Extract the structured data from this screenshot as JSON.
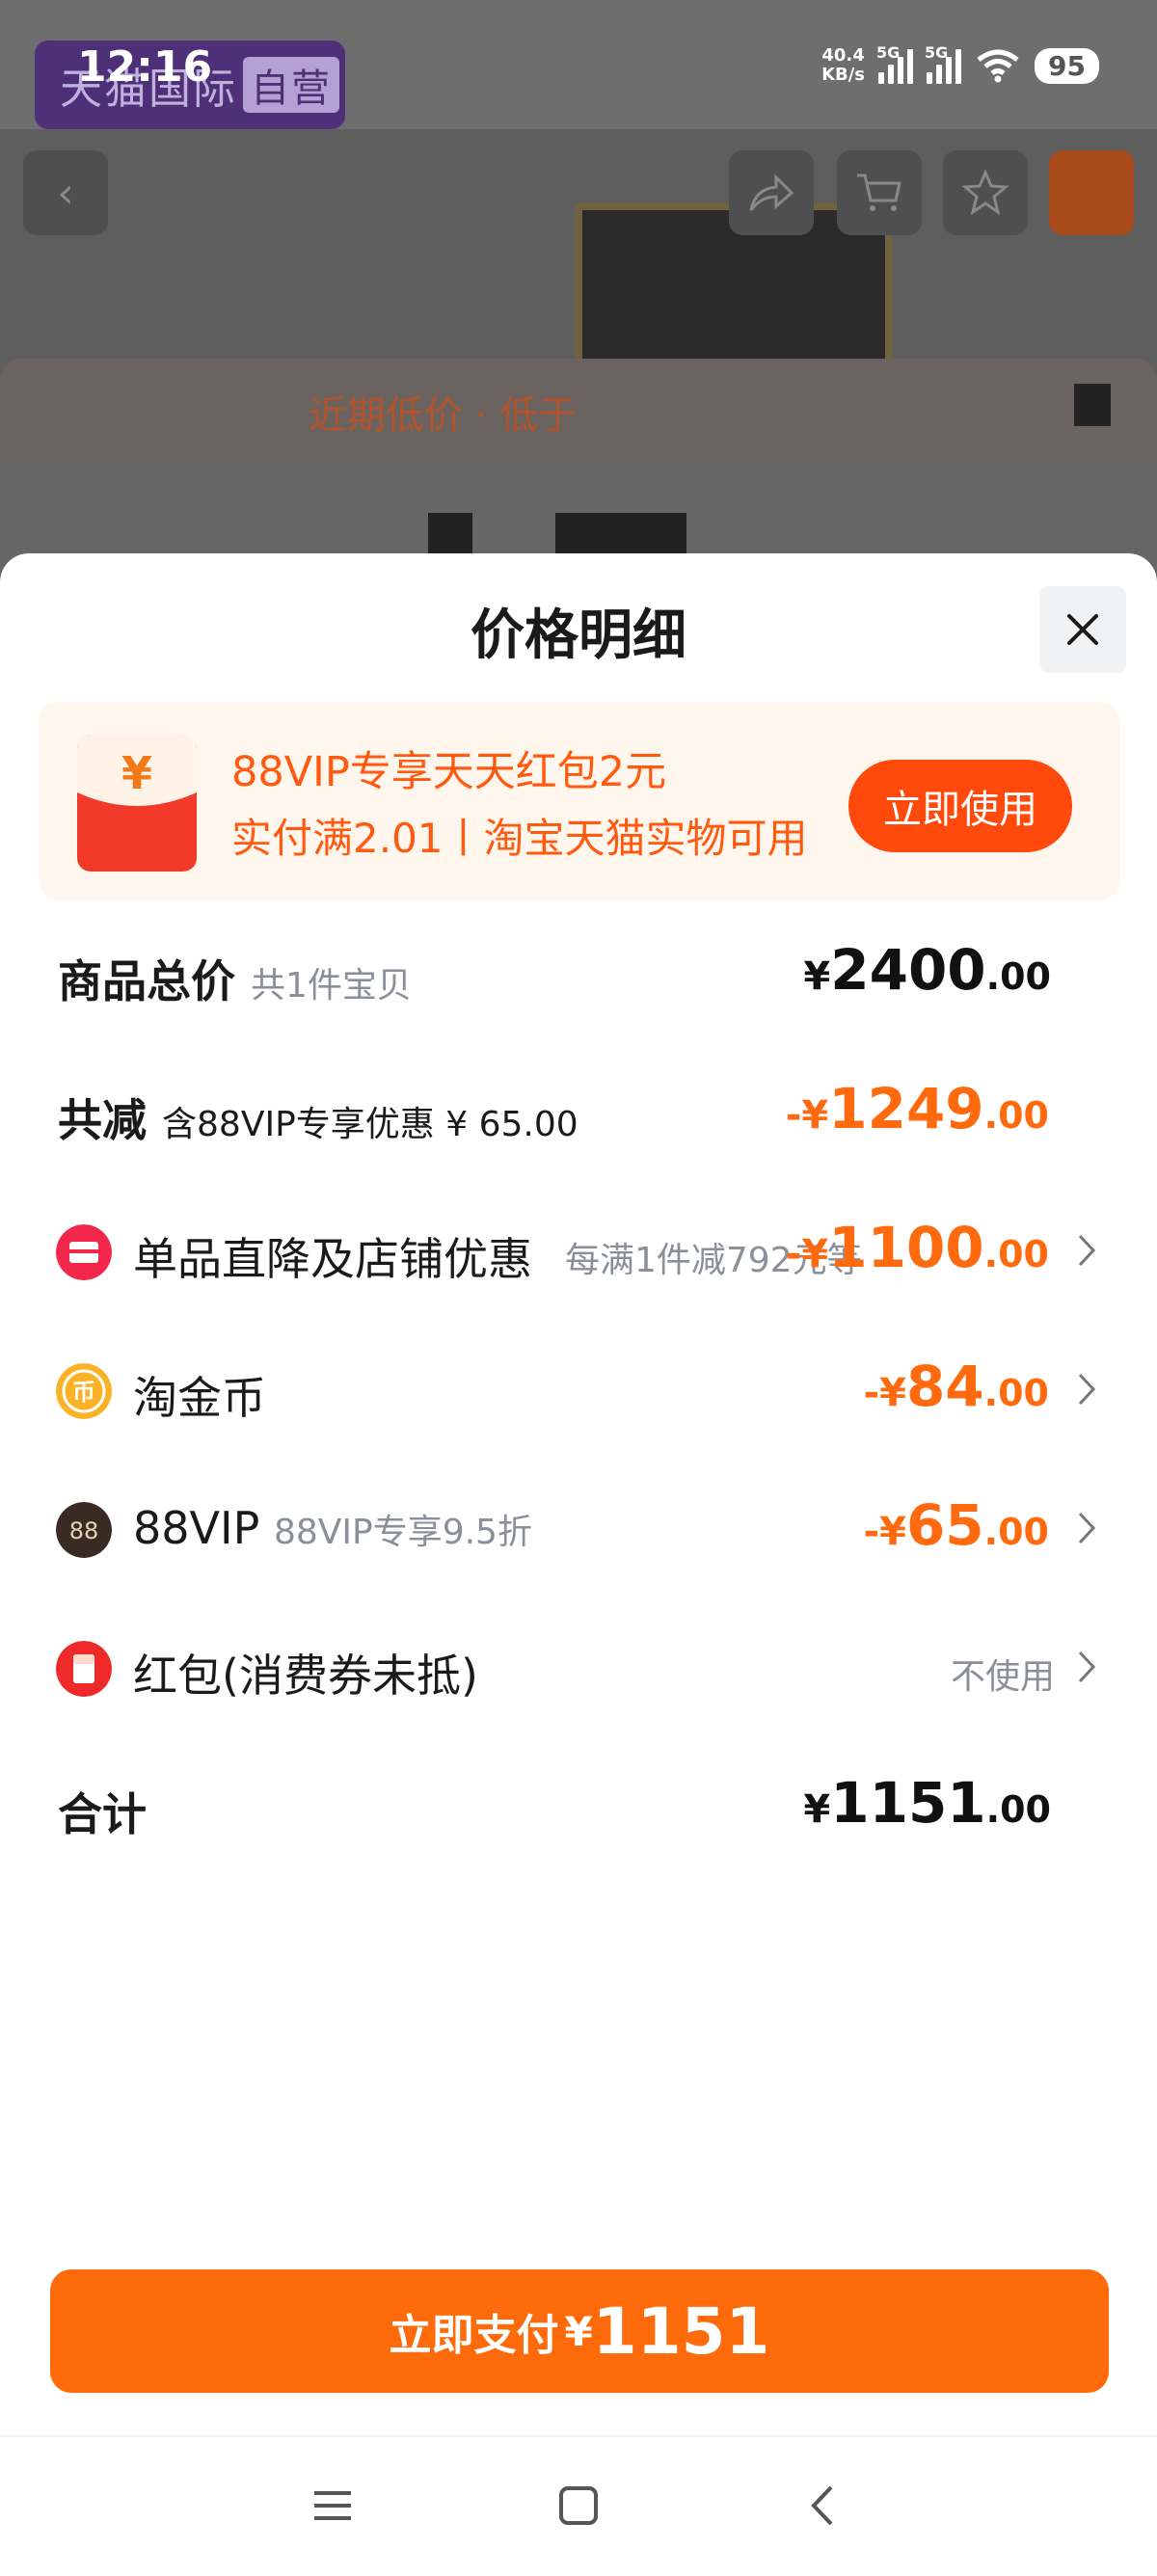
{
  "status_bar": {
    "time": "12:16",
    "net_speed": "40.4",
    "net_unit": "KB/s",
    "sig1": "5G",
    "sig2": "5G",
    "battery": "95"
  },
  "background_page": {
    "brand": "天猫国际",
    "brand_tag": "自营",
    "promo_text": "近期低价 · 低于"
  },
  "sheet": {
    "title": "价格明细",
    "coupon": {
      "title": "88VIP专享天天红包2元",
      "subtitle": "实付满2.01丨淘宝天猫实物可用",
      "button": "立即使用"
    },
    "rows": {
      "total": {
        "label": "商品总价",
        "note": "共1件宝贝",
        "currency": "¥",
        "int": "2400",
        "dec": ".00"
      },
      "discount_total": {
        "label": "共减",
        "note": "含88VIP专享优惠 ¥ 65.00",
        "currency": "-¥",
        "int": "1249",
        "dec": ".00"
      },
      "shop": {
        "label": "单品直降及店铺优惠",
        "detail": "每满1件减792元等",
        "currency": "-¥",
        "int": "1100",
        "dec": ".00"
      },
      "coin": {
        "label": "淘金币",
        "currency": "-¥",
        "int": "84",
        "dec": ".00"
      },
      "vip": {
        "label": "88VIP",
        "note": "88VIP专享9.5折",
        "icon_text": "88",
        "currency": "-¥",
        "int": "65",
        "dec": ".00"
      },
      "redpacket": {
        "label": "红包(消费券未抵)",
        "detail": "不使用"
      },
      "sum": {
        "label": "合计",
        "currency": "¥",
        "int": "1151",
        "dec": ".00"
      }
    },
    "pay_button": {
      "label": "立即支付",
      "currency": "¥",
      "amount": "1151"
    }
  },
  "colors": {
    "accent_orange": "#ff6a0a",
    "price_orange": "#ff6a0e",
    "coupon_bg": "#fff6ee"
  },
  "icons": [
    "back-icon",
    "share-icon",
    "cart-icon",
    "favorite-icon",
    "close-icon",
    "red-packet-icon",
    "shop-discount-icon",
    "coin-icon",
    "vip-icon",
    "chevron-right-icon",
    "menu-icon",
    "home-icon",
    "back-nav-icon"
  ]
}
